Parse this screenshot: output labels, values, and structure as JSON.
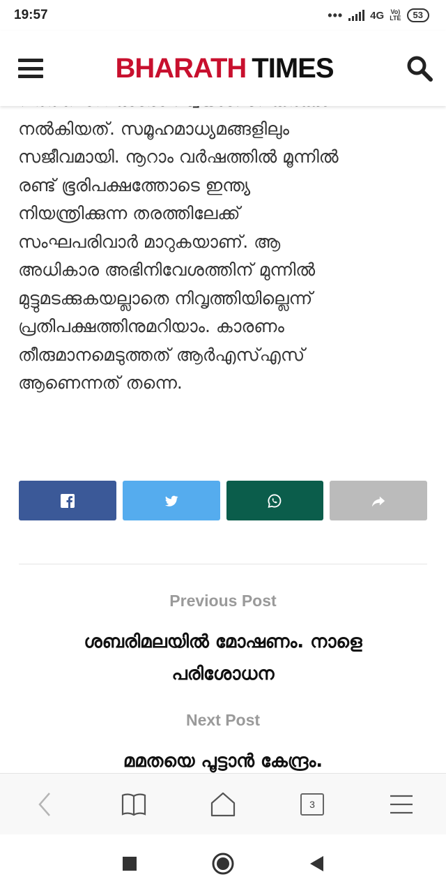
{
  "status_bar": {
    "time": "19:57",
    "network": "4G",
    "lte_top": "Vo)",
    "lte_bottom": "LTE",
    "battery": "53"
  },
  "header": {
    "logo_part1": "BHARATH",
    "logo_part2": "TIMES",
    "menu_icon": "hamburger-menu-icon",
    "search_icon": "search-icon"
  },
  "article": {
    "lines": [
      "വർത്തമാന ഓരോ സ്വയംസേവകർക്കും",
      "നൽകിയത്. സമൂഹമാധ്യമങ്ങളിലും",
      "സജീവമായി. നൂറാം വർഷത്തിൽ മൂന്നിൽ",
      "രണ്ട് ഭൂരിപക്ഷത്തോടെ ഇന്ത്യ",
      "നിയന്ത്രിക്കുന്ന തരത്തിലേക്ക്",
      "സംഘപരിവാർ മാറുകയാണ്. ആ",
      "അധികാര അഭിനിവേശത്തിന് മുന്നിൽ",
      "മുട്ടുമടക്കുകയല്ലാതെ നിവൃത്തിയില്ലെന്ന്",
      "പ്രതിപക്ഷത്തിനുമറിയാം. കാരണം",
      "തീരുമാനമെടുത്തത് ആർഎസ്എസ്",
      "ആണെന്നത് തന്നെ."
    ]
  },
  "share": {
    "buttons": [
      {
        "icon": "facebook-icon",
        "color": "#3b5998"
      },
      {
        "icon": "twitter-icon",
        "color": "#55acee"
      },
      {
        "icon": "whatsapp-icon",
        "color": "#0b5d4b"
      },
      {
        "icon": "share-icon",
        "color": "#bbbbbb"
      }
    ]
  },
  "post_nav": {
    "previous_label": "Previous Post",
    "previous_title": "ശബരിമലയിൽ മോഷണം. നാളെ പരിശോധന",
    "next_label": "Next Post",
    "next_title": "മമതയെ പൂട്ടാൻ കേന്ദ്രം."
  },
  "browser_toolbar": {
    "back_icon": "back-chevron-icon",
    "bookmarks_icon": "book-icon",
    "home_icon": "home-icon",
    "tab_count": "3",
    "menu_icon": "menu-lines-icon"
  },
  "nav_bar": {
    "recents_icon": "square-icon",
    "home_icon": "circle-home-icon",
    "back_icon": "triangle-back-icon"
  },
  "colors": {
    "brand_red": "#c8102e",
    "text": "#333333",
    "muted": "#9a9a9a"
  }
}
